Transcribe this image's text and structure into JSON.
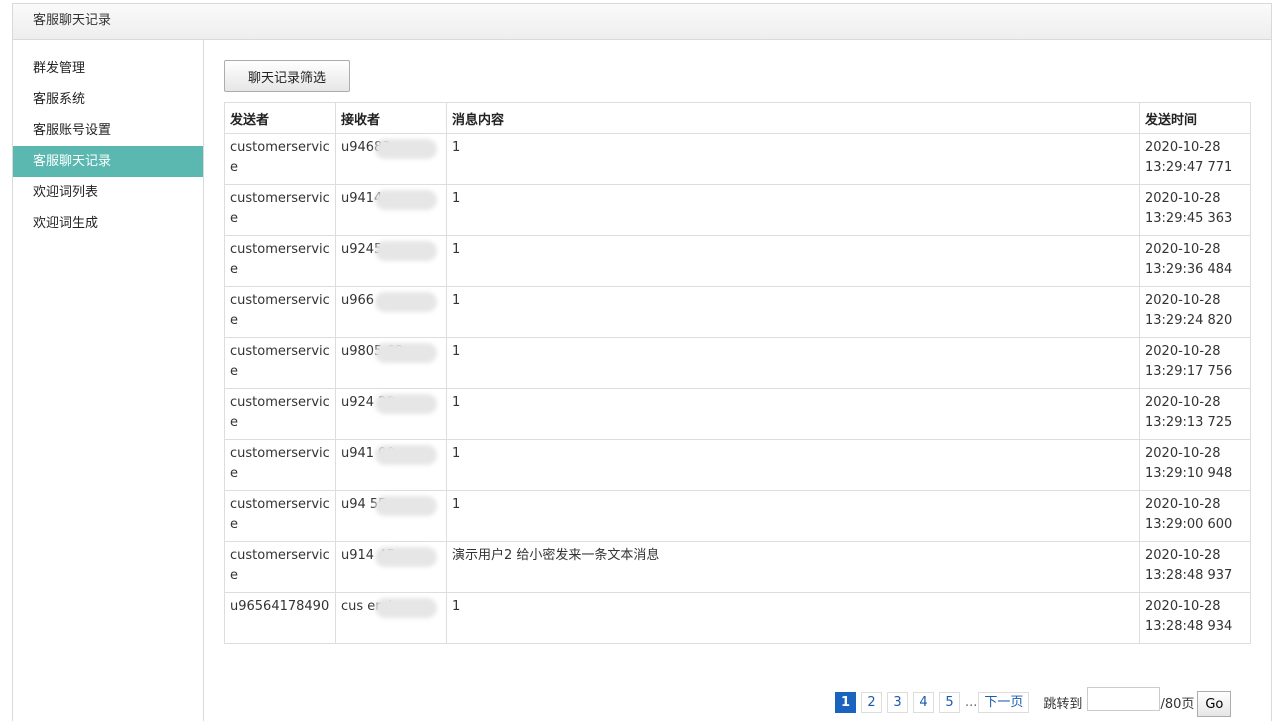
{
  "header": {
    "title": "客服聊天记录"
  },
  "sidebar": {
    "items": [
      {
        "label": "群发管理"
      },
      {
        "label": "客服系统"
      },
      {
        "label": "客服账号设置"
      },
      {
        "label": "客服聊天记录"
      },
      {
        "label": "欢迎词列表"
      },
      {
        "label": "欢迎词生成"
      }
    ]
  },
  "main": {
    "filter_button": "聊天记录筛选",
    "table": {
      "headers": [
        "发送者",
        "接收者",
        "消息内容",
        "发送时间"
      ],
      "rows": [
        {
          "sender": "customerservice",
          "receiver": "u94683",
          "content": "1",
          "date": "2020-10-28",
          "time": "13:29:47 771"
        },
        {
          "sender": "customerservice",
          "receiver": "u9414",
          "content": "1",
          "date": "2020-10-28",
          "time": "13:29:45 363"
        },
        {
          "sender": "customerservice",
          "receiver": "u9245",
          "content": "1",
          "date": "2020-10-28",
          "time": "13:29:36 484"
        },
        {
          "sender": "customerservice",
          "receiver": "u966",
          "content": "1",
          "date": "2020-10-28",
          "time": "13:29:24 820"
        },
        {
          "sender": "customerservice",
          "receiver": "u9805 68",
          "content": "1",
          "date": "2020-10-28",
          "time": "13:29:17 756"
        },
        {
          "sender": "customerservice",
          "receiver": "u924 29",
          "content": "1",
          "date": "2020-10-28",
          "time": "13:29:13 725"
        },
        {
          "sender": "customerservice",
          "receiver": "u941 00",
          "content": "1",
          "date": "2020-10-28",
          "time": "13:29:10 948"
        },
        {
          "sender": "customerservice",
          "receiver": "u94 55",
          "content": "1",
          "date": "2020-10-28",
          "time": "13:29:00 600"
        },
        {
          "sender": "customerservice",
          "receiver": "u914 45",
          "content": "演示用户2 给小密发来一条文本消息",
          "date": "2020-10-28",
          "time": "13:28:48 937"
        },
        {
          "sender": "u96564178490",
          "receiver": "cus ervice",
          "content": "1",
          "date": "2020-10-28",
          "time": "13:28:48 934"
        }
      ]
    }
  },
  "pagination": {
    "pages": [
      "1",
      "2",
      "3",
      "4",
      "5"
    ],
    "current": "1",
    "ellipsis": "...",
    "next": "下一页",
    "jump_label": "跳转到",
    "jump_value": "",
    "total": "/80页",
    "go": "Go"
  }
}
